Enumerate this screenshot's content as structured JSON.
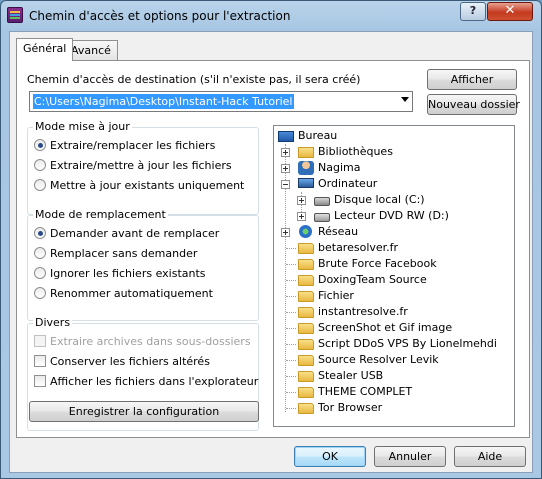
{
  "window": {
    "title": "Chemin d'accès et options pour l'extraction",
    "help_label": "?",
    "close_label": "✕"
  },
  "tabs": [
    {
      "label": "Général"
    },
    {
      "label": "Avancé"
    }
  ],
  "destination": {
    "label": "Chemin d'accès de destination (s'il n'existe pas, il sera créé)",
    "value": "C:\\Users\\Nagima\\Desktop\\Instant-Hack Tutoriel",
    "show_button": "Afficher",
    "new_folder_button": "Nouveau dossier"
  },
  "update_mode": {
    "title": "Mode mise à jour",
    "options": [
      {
        "label": "Extraire/remplacer les fichiers",
        "selected": true
      },
      {
        "label": "Extraire/mettre à jour les fichiers",
        "selected": false
      },
      {
        "label": "Mettre à jour existants uniquement",
        "selected": false
      }
    ]
  },
  "replace_mode": {
    "title": "Mode de remplacement",
    "options": [
      {
        "label": "Demander avant de remplacer",
        "selected": true
      },
      {
        "label": "Remplacer sans demander",
        "selected": false
      },
      {
        "label": "Ignorer les fichiers existants",
        "selected": false
      },
      {
        "label": "Renommer automatiquement",
        "selected": false
      }
    ]
  },
  "misc": {
    "title": "Divers",
    "options": [
      {
        "label": "Extraire archives dans sous-dossiers",
        "checked": false,
        "disabled": true
      },
      {
        "label": "Conserver les fichiers altérés",
        "checked": false,
        "disabled": false
      },
      {
        "label": "Afficher les fichiers dans l'explorateur",
        "checked": false,
        "disabled": false
      }
    ]
  },
  "save_config_button": "Enregistrer la configuration",
  "tree": {
    "items": [
      {
        "label": "Bureau",
        "icon": "desktop-icon"
      },
      {
        "label": "Bibliothèques",
        "icon": "library-icon"
      },
      {
        "label": "Nagima",
        "icon": "user-icon"
      },
      {
        "label": "Ordinateur",
        "icon": "computer-icon"
      },
      {
        "label": "Disque local (C:)",
        "icon": "disk-icon"
      },
      {
        "label": "Lecteur DVD RW (D:)",
        "icon": "dvd-icon"
      },
      {
        "label": "Réseau",
        "icon": "network-icon"
      },
      {
        "label": "betaresolver.fr",
        "icon": "folder-icon"
      },
      {
        "label": "Brute Force Facebook",
        "icon": "folder-icon"
      },
      {
        "label": "DoxingTeam Source",
        "icon": "folder-icon"
      },
      {
        "label": "Fichier",
        "icon": "folder-icon"
      },
      {
        "label": "instantresolve.fr",
        "icon": "folder-icon"
      },
      {
        "label": "ScreenShot et Gif image",
        "icon": "folder-icon"
      },
      {
        "label": "Script DDoS VPS By Lionelmehdi",
        "icon": "folder-icon"
      },
      {
        "label": "Source Resolver Levik",
        "icon": "folder-icon"
      },
      {
        "label": "Stealer USB",
        "icon": "folder-icon"
      },
      {
        "label": "THEME COMPLET",
        "icon": "folder-icon"
      },
      {
        "label": "Tor Browser",
        "icon": "folder-icon"
      }
    ]
  },
  "footer": {
    "ok": "OK",
    "cancel": "Annuler",
    "help": "Aide"
  }
}
